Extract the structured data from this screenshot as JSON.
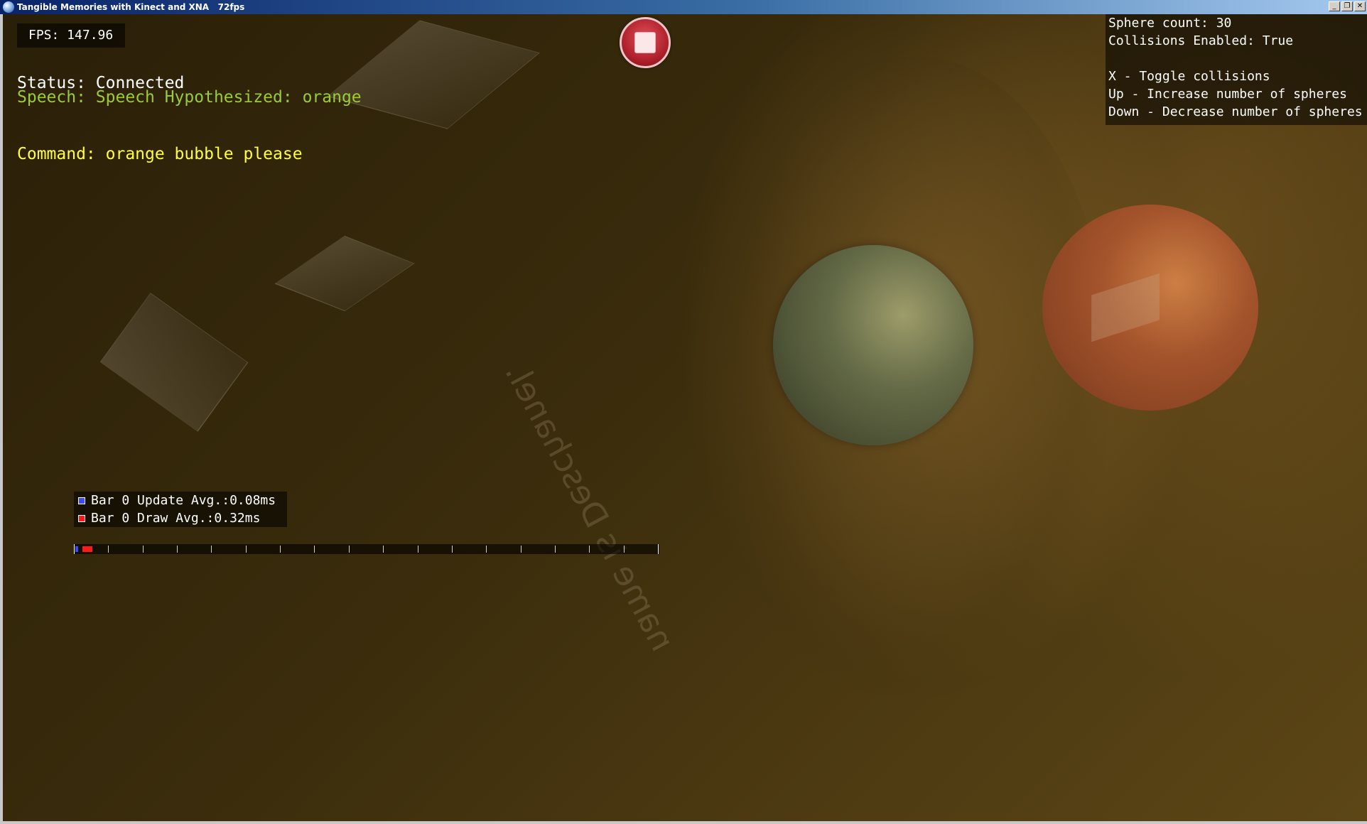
{
  "window": {
    "title": "Tangible Memories with Kinect and XNA   72fps"
  },
  "overlay": {
    "fps": "FPS: 147.96",
    "status": "Status: Connected",
    "speech": "Speech: Speech Hypothesized: orange",
    "command": "Command: orange bubble please"
  },
  "info_panel": {
    "lines": [
      "Sphere count: 30",
      "Collisions Enabled: True",
      "",
      "X - Toggle collisions",
      "Up - Increase number of spheres",
      "Down - Decrease number of spheres"
    ]
  },
  "perf": {
    "update_label": "Bar 0 Update Avg.:0.08ms",
    "draw_label": "Bar 0 Draw Avg.:0.32ms",
    "update_ms": 0.08,
    "draw_ms": 0.32,
    "update_color": "#3b4cff",
    "draw_color": "#ff1a1a"
  },
  "scene": {
    "mirrored_text": "name is Deschanel.",
    "spheres": [
      {
        "name": "green-sphere",
        "color": "#6e7a52"
      },
      {
        "name": "orange-sphere",
        "color": "#b05a2e"
      }
    ],
    "record_button": {
      "icon": "stop-icon",
      "color": "#b0222c"
    }
  }
}
